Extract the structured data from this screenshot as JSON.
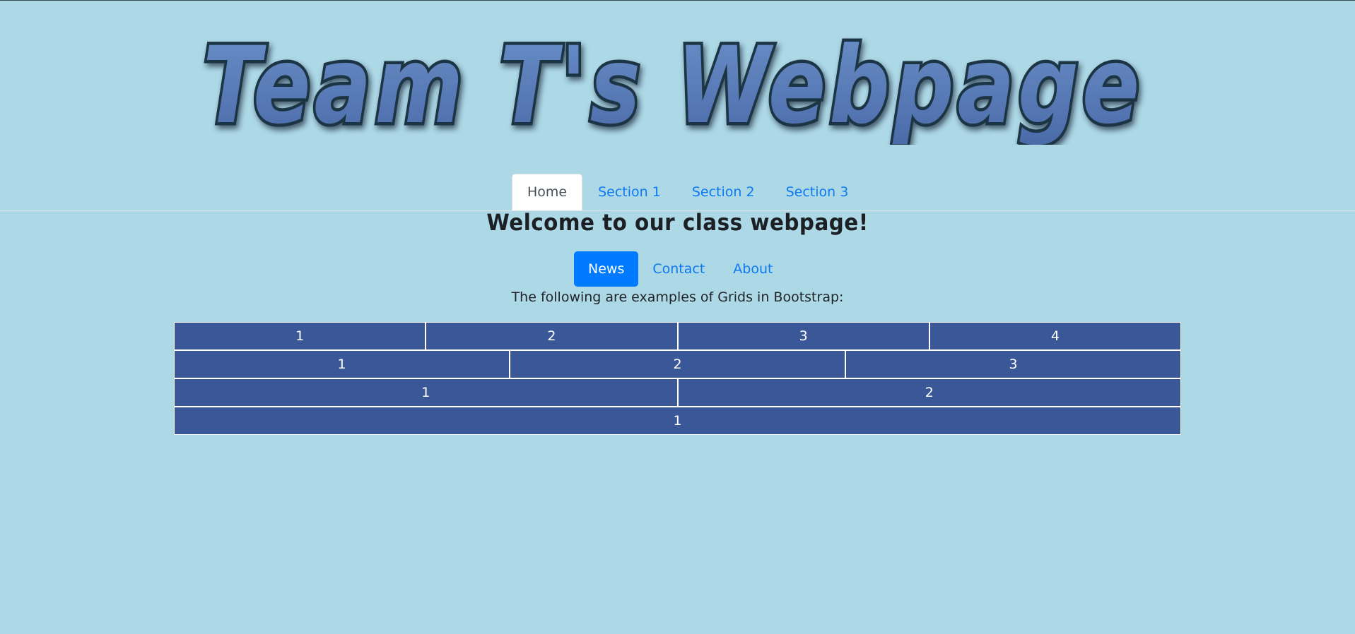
{
  "banner": {
    "title": "Team T's Webpage"
  },
  "tabs": [
    {
      "label": "Home",
      "active": true
    },
    {
      "label": "Section 1",
      "active": false
    },
    {
      "label": "Section 2",
      "active": false
    },
    {
      "label": "Section 3",
      "active": false
    }
  ],
  "heading": "Welcome to our class webpage!",
  "pills": [
    {
      "label": "News",
      "active": true
    },
    {
      "label": "Contact",
      "active": false
    },
    {
      "label": "About",
      "active": false
    }
  ],
  "intro": "The following are examples of Grids in Bootstrap:",
  "grid": {
    "rows": [
      [
        "1",
        "2",
        "3",
        "4"
      ],
      [
        "1",
        "2",
        "3"
      ],
      [
        "1",
        "2"
      ],
      [
        "1"
      ]
    ]
  },
  "colors": {
    "background": "#add8e6",
    "grid_cell": "#3a5897",
    "link": "#0d79f2",
    "pill_active": "#007bff"
  }
}
